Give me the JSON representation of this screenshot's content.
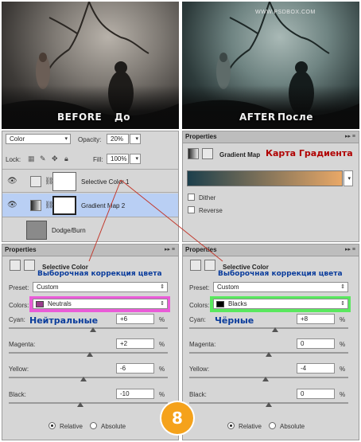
{
  "photos": {
    "before": {
      "label": "BEFORE",
      "ru": "До"
    },
    "after": {
      "label": "AFTER",
      "ru": "После",
      "watermark": "WWW.PSDBOX.COM"
    }
  },
  "layers": {
    "blend_mode": "Color",
    "opacity_label": "Opacity:",
    "opacity_value": "20%",
    "lock_label": "Lock:",
    "fill_label": "Fill:",
    "fill_value": "100%",
    "items": [
      {
        "name": "Selective Color 1"
      },
      {
        "name": "Gradient Map 2"
      },
      {
        "name": "Dodge/Burn"
      }
    ]
  },
  "gradient_props": {
    "tab": "Properties",
    "title": "Gradient Map",
    "ru_title": "Карта Градиента",
    "dither_label": "Dither",
    "reverse_label": "Reverse",
    "gradient_from": "#1c3f4c",
    "gradient_to": "#e9a867"
  },
  "selective_left": {
    "tab": "Properties",
    "title": "Selective Color",
    "ru_title": "Выборочная коррекция цвета",
    "preset_label": "Preset:",
    "preset_value": "Custom",
    "colors_label": "Colors:",
    "colors_value": "Neutrals",
    "colors_ru": "Нейтральные",
    "swatch": "#9a3c8c",
    "highlight": "#ea5bd8",
    "cyan_label": "Cyan:",
    "cyan_value": "+6",
    "magenta_label": "Magenta:",
    "magenta_value": "+2",
    "yellow_label": "Yellow:",
    "yellow_value": "-6",
    "black_label": "Black:",
    "black_value": "-10",
    "pct": "%",
    "relative_label": "Relative",
    "absolute_label": "Absolute",
    "mode_selected": "Relative"
  },
  "selective_right": {
    "tab": "Properties",
    "title": "Selective Color",
    "ru_title": "Выборочная коррекция цвета",
    "preset_label": "Preset:",
    "preset_value": "Custom",
    "colors_label": "Colors:",
    "colors_value": "Blacks",
    "colors_ru": "Чёрные",
    "swatch": "#000000",
    "highlight": "#59e85e",
    "cyan_label": "Cyan:",
    "cyan_value": "+8",
    "magenta_label": "Magenta:",
    "magenta_value": "0",
    "yellow_label": "Yellow:",
    "yellow_value": "-4",
    "black_label": "Black:",
    "black_value": "0",
    "pct": "%",
    "relative_label": "Relative",
    "absolute_label": "Absolute",
    "mode_selected": "Relative"
  },
  "step_badge": {
    "number": "8",
    "color": "#f5a21b"
  }
}
